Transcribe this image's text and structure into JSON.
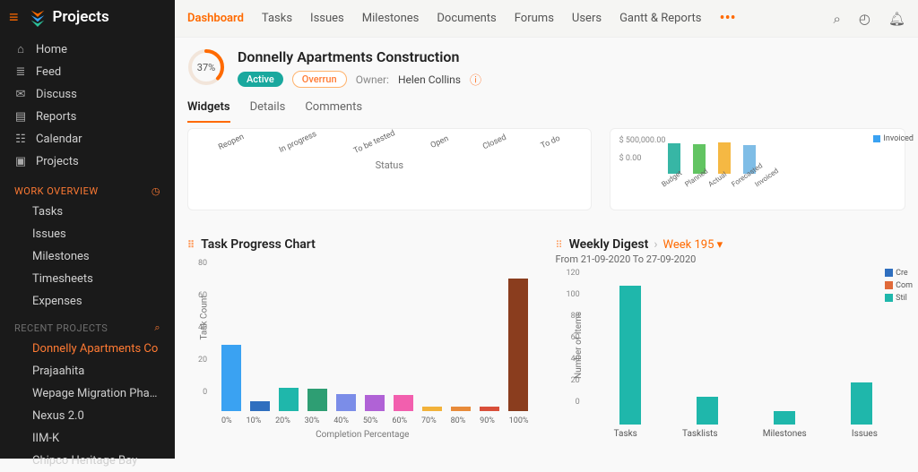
{
  "app": {
    "name": "Projects"
  },
  "sidebar": {
    "main": [
      {
        "label": "Home",
        "icon": "⌂"
      },
      {
        "label": "Feed",
        "icon": "≣"
      },
      {
        "label": "Discuss",
        "icon": "✉"
      },
      {
        "label": "Reports",
        "icon": "▤"
      },
      {
        "label": "Calendar",
        "icon": "☷"
      },
      {
        "label": "Projects",
        "icon": "▣"
      }
    ],
    "work_section": "WORK OVERVIEW",
    "work": [
      {
        "label": "Tasks"
      },
      {
        "label": "Issues"
      },
      {
        "label": "Milestones"
      },
      {
        "label": "Timesheets"
      },
      {
        "label": "Expenses"
      }
    ],
    "recent_section": "RECENT PROJECTS",
    "recent": [
      {
        "label": "Donnelly Apartments Co",
        "active": true
      },
      {
        "label": "Prajaahita"
      },
      {
        "label": "Wepage Migration Phase"
      },
      {
        "label": "Nexus 2.0"
      },
      {
        "label": "IIM-K"
      },
      {
        "label": "Chipco Heritage Bay"
      }
    ]
  },
  "topnav": {
    "tabs": [
      "Dashboard",
      "Tasks",
      "Issues",
      "Milestones",
      "Documents",
      "Forums",
      "Users",
      "Gantt & Reports"
    ],
    "active": "Dashboard"
  },
  "project": {
    "title": "Donnelly Apartments Construction",
    "progress_pct": "37%",
    "status_pill": "Active",
    "overrun_pill": "Overrun",
    "owner_label": "Owner:",
    "owner_name": "Helen Collins"
  },
  "subtabs": {
    "items": [
      "Widgets",
      "Details",
      "Comments"
    ],
    "active": "Widgets"
  },
  "status_card": {
    "categories": [
      "Reopen",
      "In progress",
      "To be tested",
      "Open",
      "Closed",
      "To do"
    ],
    "xlabel": "Status"
  },
  "budget_card": {
    "yticks": [
      "$ 500,000.00",
      "$ 0.00"
    ],
    "categories": [
      "Budget",
      "Planned",
      "Actual",
      "Forecasted",
      "Invoiced"
    ],
    "legend": "Invoiced"
  },
  "tpc": {
    "title": "Task Progress Chart",
    "ylabel": "Task Count",
    "xlabel": "Completion Percentage"
  },
  "weekly": {
    "title": "Weekly Digest",
    "week_label": "Week 195",
    "range": "From 21-09-2020 To 27-09-2020",
    "ylabel": "Number of Items",
    "legend": [
      "Cre",
      "Com",
      "Stil"
    ]
  },
  "chart_data": [
    {
      "id": "budget_overview",
      "type": "bar",
      "categories": [
        "Budget",
        "Planned",
        "Actual",
        "Forecasted",
        "Invoiced"
      ],
      "values": [
        600000,
        580000,
        620000,
        560000,
        0
      ],
      "ylim": [
        0,
        700000
      ],
      "colors": [
        "#37b6a5",
        "#62c462",
        "#f5b843",
        "#7fbde6",
        "#ccc"
      ]
    },
    {
      "id": "task_progress",
      "type": "bar",
      "xlabel": "Completion Percentage",
      "ylabel": "Task Count",
      "categories": [
        "0%",
        "10%",
        "20%",
        "30%",
        "40%",
        "50%",
        "60%",
        "70%",
        "80%",
        "90%",
        "100%"
      ],
      "values": [
        42,
        6,
        15,
        14,
        11,
        10,
        10,
        3,
        3,
        3,
        84
      ],
      "colors": [
        "#3aa2f2",
        "#2f6fbf",
        "#1fb7ab",
        "#2e9e73",
        "#7b8de8",
        "#b062d6",
        "#f25fae",
        "#f2b23a",
        "#e88b3a",
        "#d94f3a",
        "#8a3d1e"
      ],
      "ylim": [
        0,
        85
      ],
      "yticks": [
        0,
        20,
        40,
        60,
        80
      ]
    },
    {
      "id": "weekly_digest",
      "type": "bar",
      "xlabel": "",
      "ylabel": "Number of Items",
      "categories": [
        "Tasks",
        "Tasklists",
        "Milestones",
        "Issues"
      ],
      "values": [
        124,
        25,
        12,
        38
      ],
      "color": "#1fb7ab",
      "ylim": [
        0,
        130
      ],
      "yticks": [
        0,
        20,
        40,
        60,
        80,
        100,
        120
      ]
    }
  ]
}
